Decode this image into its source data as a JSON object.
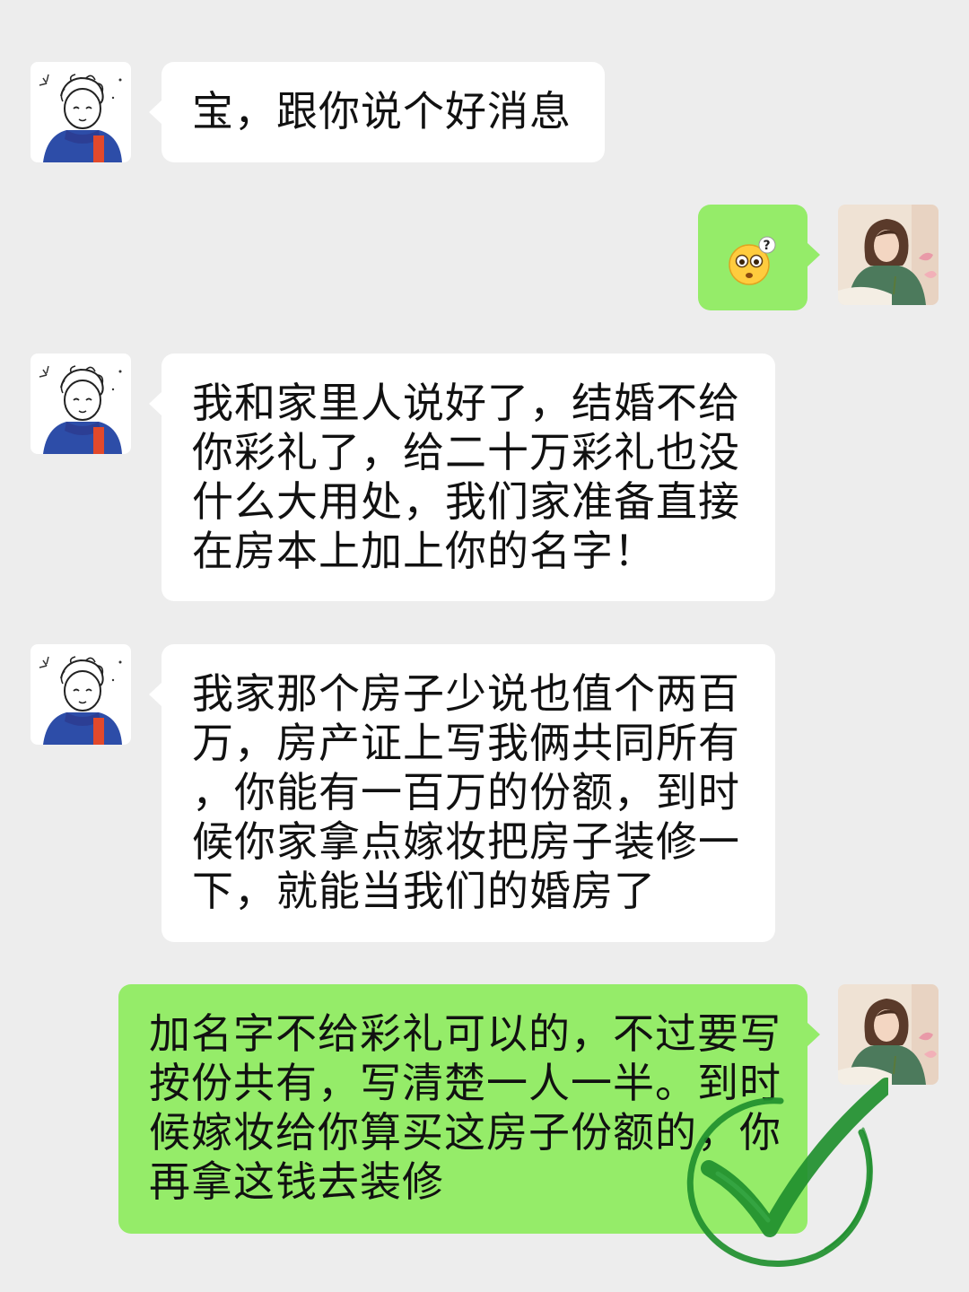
{
  "conversation": {
    "messages": [
      {
        "sender": "boyfriend",
        "lines": [
          "宝，跟你说个好消息"
        ]
      },
      {
        "sender": "me",
        "type": "emoji",
        "emoji_name": "confused-face-emoji"
      },
      {
        "sender": "boyfriend",
        "lines": [
          "我和家里人说好了，结婚不给",
          "你彩礼了，给二十万彩礼也没",
          "什么大用处，我们家准备直接",
          "在房本上加上你的名字！"
        ]
      },
      {
        "sender": "boyfriend",
        "lines": [
          "我家那个房子少说也值个两百",
          "万，房产证上写我俩共同所有",
          "，你能有一百万的份额，到时",
          "候你家拿点嫁妆把房子装修一",
          "下，就能当我们的婚房了"
        ]
      },
      {
        "sender": "me",
        "lines": [
          "加名字不给彩礼可以的，不过要写",
          "按份共有，写清楚一人一半。到时",
          "候嫁妆给你算买这房子份额的，你",
          "再拿这钱去装修"
        ]
      }
    ]
  },
  "colors": {
    "background": "#ededed",
    "incoming_bubble": "#ffffff",
    "outgoing_bubble": "#95ec69",
    "checkmark": "#1f8f2e"
  },
  "icons": {
    "boyfriend_avatar": "cartoon-boy-avatar",
    "me_avatar": "woman-portrait-avatar",
    "overlay": "green-checkmark-stamp"
  }
}
